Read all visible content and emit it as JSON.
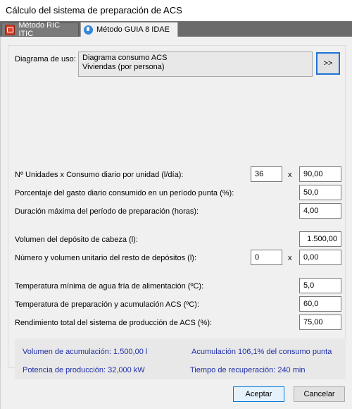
{
  "window": {
    "title": "Cálculo del sistema de preparación de ACS"
  },
  "tabs": [
    {
      "label": "Método RIC ITIC",
      "icon": "ric-itic-icon",
      "active": false
    },
    {
      "label": "Método GUIA 8 IDAE",
      "icon": "idae-icon",
      "active": true
    }
  ],
  "diagram": {
    "label": "Diagrama de uso:",
    "line1": "Diagrama consumo ACS",
    "line2": "Viviendas (por persona)",
    "button": ">>"
  },
  "fields": {
    "units_label": "Nº Unidades x Consumo diario por unidad (l/día):",
    "units_value": "36",
    "units_x": "x",
    "consumo_value": "90,00",
    "porcentaje_label": "Porcentaje del gasto diario consumido en un período punta (%):",
    "porcentaje_value": "50,0",
    "duracion_label": "Duración máxima del período de preparación (horas):",
    "duracion_value": "4,00",
    "volumen_cabeza_label": "Volumen del depósito de cabeza (l):",
    "volumen_cabeza_value": "1.500,00",
    "resto_label": "Número y volumen unitario del resto de depósitos (l):",
    "resto_num_value": "0",
    "resto_x": "x",
    "resto_vol_value": "0,00",
    "temp_fria_label": "Temperatura mínima de agua fría de alimentación (ºC):",
    "temp_fria_value": "5,0",
    "temp_prep_label": "Temperatura de preparación y acumulación ACS (ºC):",
    "temp_prep_value": "60,0",
    "rendimiento_label": "Rendimiento total del sistema de producción de ACS (%):",
    "rendimiento_value": "75,00"
  },
  "results": {
    "volumen": "Volumen de acumulación: 1.500,00 l",
    "acumulacion": "Acumulación 106,1% del consumo punta",
    "potencia": "Potencia de producción: 32,000 kW",
    "tiempo": "Tiempo de recuperación: 240 min"
  },
  "buttons": {
    "accept": "Aceptar",
    "cancel": "Cancelar"
  },
  "colors": {
    "result_text": "#1f2fa8",
    "accent": "#0078d7"
  }
}
